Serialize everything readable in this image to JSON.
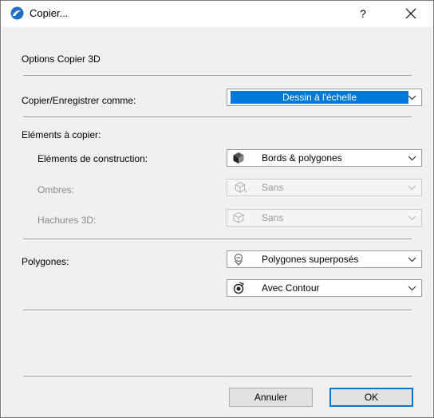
{
  "window": {
    "title": "Copier...",
    "help_label": "?",
    "icon": "archicad-logo-icon"
  },
  "section_title": "Options Copier 3D",
  "copy_as": {
    "label": "Copier/Enregistrer comme:",
    "value": "Dessin à l'échelle"
  },
  "elements_heading": "Eléments à copier:",
  "construction": {
    "label": "Eléments de construction:",
    "value": "Bords & polygones",
    "icon": "cube-shaded-icon"
  },
  "shadows": {
    "label": "Ombres:",
    "value": "Sans",
    "icon": "cube-shadow-icon",
    "disabled": true
  },
  "hatches": {
    "label": "Hachures 3D:",
    "value": "Sans",
    "icon": "cube-wireframe-icon",
    "disabled": true
  },
  "polygons": {
    "label": "Polygones:",
    "value": "Polygones superposés",
    "icon": "overlap-polygons-icon",
    "contour_value": "Avec Contour",
    "contour_icon": "contour-icon"
  },
  "buttons": {
    "cancel": "Annuler",
    "ok": "OK"
  },
  "colors": {
    "accent": "#0078d7",
    "panel_bg": "#f0f0f0",
    "disabled_text": "#8a8a8a"
  }
}
